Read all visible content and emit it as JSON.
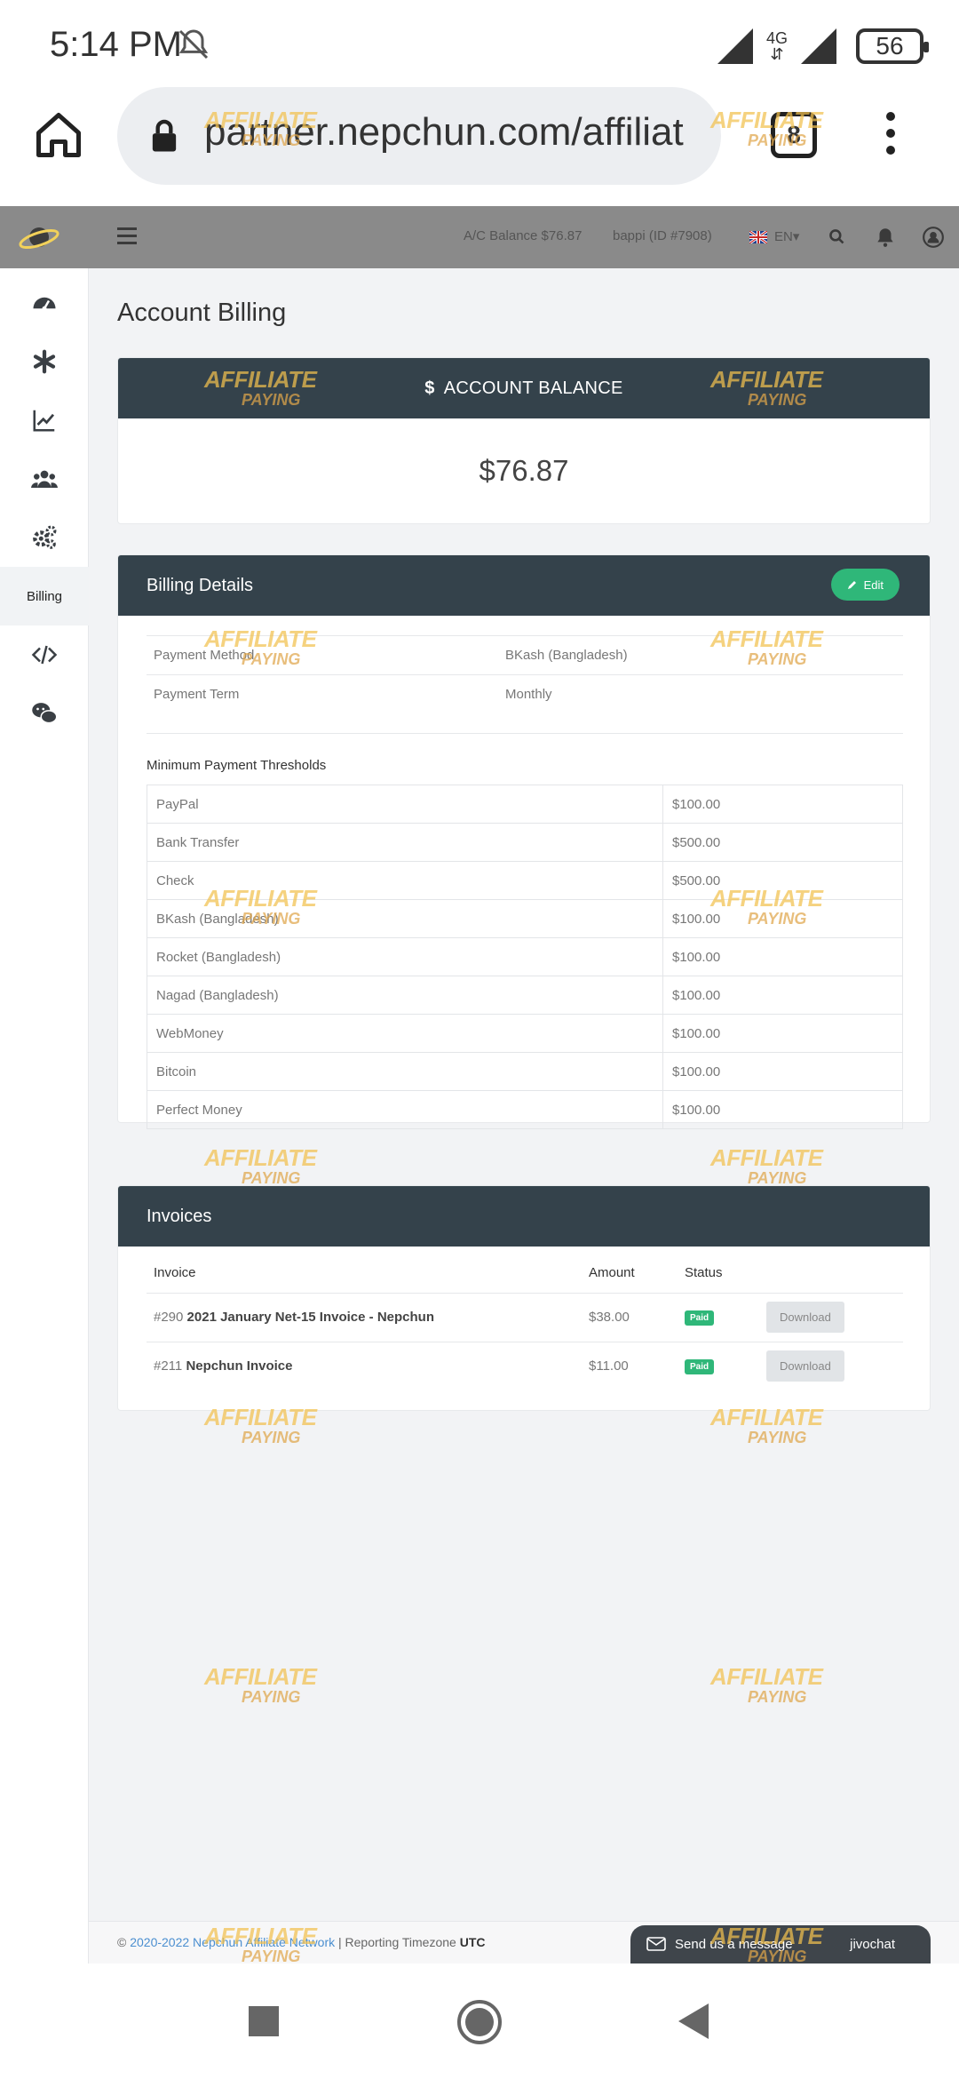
{
  "status_bar": {
    "time": "5:14 PM",
    "network": "4G",
    "battery": "56"
  },
  "browser": {
    "url": "partner.nepchun.com/affiliat",
    "tab_count": "8"
  },
  "header": {
    "balance": "A/C Balance $76.87",
    "user": "bappi (ID #7908)",
    "language": "EN"
  },
  "sidebar": {
    "active_label": "Billing"
  },
  "page": {
    "title": "Account Billing"
  },
  "balance_card": {
    "title": "ACCOUNT BALANCE",
    "currency_icon": "$",
    "value": "$76.87"
  },
  "billing_details": {
    "title": "Billing Details",
    "edit_label": "Edit",
    "rows": [
      {
        "key": "Payment Method",
        "value": "BKash (Bangladesh)"
      },
      {
        "key": "Payment Term",
        "value": "Monthly"
      }
    ],
    "thresholds_label": "Minimum Payment Thresholds",
    "thresholds": [
      {
        "method": "PayPal",
        "amount": "$100.00"
      },
      {
        "method": "Bank Transfer",
        "amount": "$500.00"
      },
      {
        "method": "Check",
        "amount": "$500.00"
      },
      {
        "method": "BKash (Bangladesh)",
        "amount": "$100.00"
      },
      {
        "method": "Rocket (Bangladesh)",
        "amount": "$100.00"
      },
      {
        "method": "Nagad (Bangladesh)",
        "amount": "$100.00"
      },
      {
        "method": "WebMoney",
        "amount": "$100.00"
      },
      {
        "method": "Bitcoin",
        "amount": "$100.00"
      },
      {
        "method": "Perfect Money",
        "amount": "$100.00"
      }
    ]
  },
  "invoices": {
    "title": "Invoices",
    "columns": [
      "Invoice",
      "Amount",
      "Status"
    ],
    "rows": [
      {
        "number": "#290",
        "name": "2021 January Net-15 Invoice - Nepchun",
        "amount": "$38.00",
        "status": "Paid",
        "action": "Download"
      },
      {
        "number": "#211",
        "name": "Nepchun Invoice",
        "amount": "$11.00",
        "status": "Paid",
        "action": "Download"
      }
    ]
  },
  "footer": {
    "copyright": "©",
    "link": "2020-2022 Nepchun Affiliate Network",
    "separator": "| Reporting Timezone",
    "timezone": "UTC"
  },
  "chat": {
    "message": "Send us a message",
    "brand": "jivochat"
  },
  "watermark": {
    "line1": "AFFILIATE",
    "line2": "PAYING"
  },
  "colors": {
    "header_dark": "#34424b",
    "accent_green": "#2fb779",
    "app_header": "#8a8a8a"
  }
}
